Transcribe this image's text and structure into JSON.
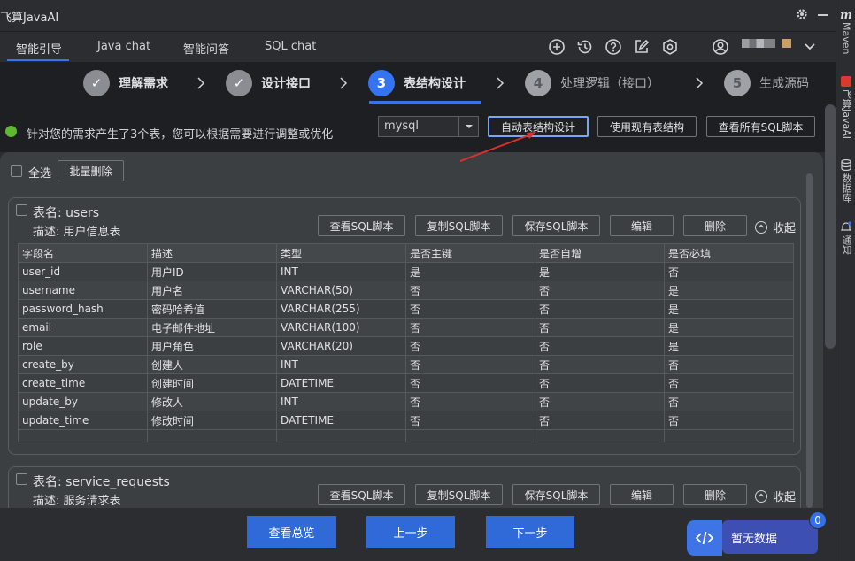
{
  "window": {
    "title": "飞算JavaAI"
  },
  "tabs": [
    {
      "label": "智能引导",
      "active": true
    },
    {
      "label": "Java chat",
      "active": false
    },
    {
      "label": "智能问答",
      "active": false
    },
    {
      "label": "SQL chat",
      "active": false
    }
  ],
  "steps": [
    {
      "index": "✓",
      "label": "理解需求",
      "state": "done"
    },
    {
      "index": "✓",
      "label": "设计接口",
      "state": "done"
    },
    {
      "index": "3",
      "label": "表结构设计",
      "state": "current"
    },
    {
      "index": "4",
      "label": "处理逻辑（接口）",
      "state": "todo"
    },
    {
      "index": "5",
      "label": "生成源码",
      "state": "todo"
    }
  ],
  "info": {
    "message": "针对您的需求产生了3个表，您可以根据需要进行调整或优化",
    "db_select": "mysql",
    "auto_design_button": "自动表结构设计",
    "use_existing_button": "使用现有表结构",
    "view_all_sql_button": "查看所有SQL脚本"
  },
  "panel": {
    "select_all_label": "全选",
    "batch_delete_button": "批量删除"
  },
  "card_actions": {
    "view_sql": "查看SQL脚本",
    "copy_sql": "复制SQL脚本",
    "save_sql": "保存SQL脚本",
    "edit": "编辑",
    "delete": "删除",
    "collapse": "收起"
  },
  "tables": [
    {
      "name": "表名: users",
      "desc": "描述: 用户信息表",
      "columns": [
        "字段名",
        "描述",
        "类型",
        "是否主键",
        "是否自增",
        "是否必填"
      ],
      "rows": [
        [
          "user_id",
          "用户ID",
          "INT",
          "是",
          "是",
          "否"
        ],
        [
          "username",
          "用户名",
          "VARCHAR(50)",
          "否",
          "否",
          "是"
        ],
        [
          "password_hash",
          "密码哈希值",
          "VARCHAR(255)",
          "否",
          "否",
          "是"
        ],
        [
          "email",
          "电子邮件地址",
          "VARCHAR(100)",
          "否",
          "否",
          "是"
        ],
        [
          "role",
          "用户角色",
          "VARCHAR(20)",
          "否",
          "否",
          "是"
        ],
        [
          "create_by",
          "创建人",
          "INT",
          "否",
          "否",
          "否"
        ],
        [
          "create_time",
          "创建时间",
          "DATETIME",
          "否",
          "否",
          "否"
        ],
        [
          "update_by",
          "修改人",
          "INT",
          "否",
          "否",
          "否"
        ],
        [
          "update_time",
          "修改时间",
          "DATETIME",
          "否",
          "否",
          "否"
        ]
      ]
    },
    {
      "name": "表名: service_requests",
      "desc": "描述: 服务请求表"
    }
  ],
  "bottom": {
    "overview_button": "查看总览",
    "prev_button": "上一步",
    "next_button": "下一步",
    "no_data_label": "暂无数据",
    "badge_count": "0"
  },
  "right_sidebar": {
    "maven_m": "m",
    "maven": "Maven",
    "feisuan": "飞算JavaAI",
    "database": "数据库",
    "notifications": "通知"
  },
  "colors": {
    "accent": "#3574f0",
    "success": "#5fb832",
    "nav_button": "#2f6ad8",
    "annotation_arrow": "#e0302c"
  }
}
